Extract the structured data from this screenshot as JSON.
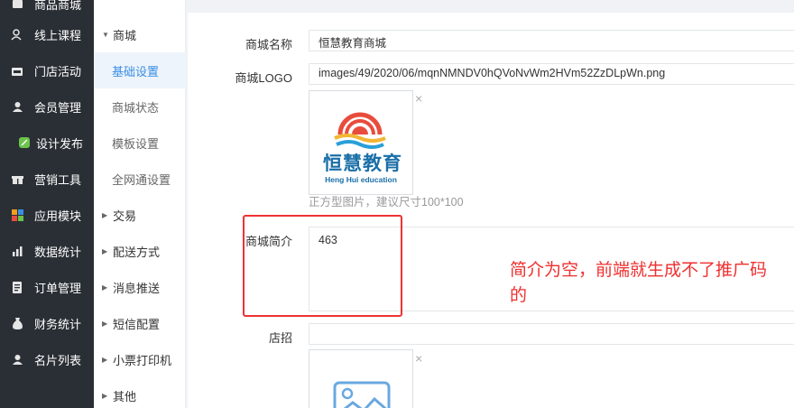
{
  "sidebar": {
    "items": [
      {
        "label": "商品商城",
        "icon": "shop-icon"
      },
      {
        "label": "线上课程",
        "icon": "course-icon"
      },
      {
        "label": "门店活动",
        "icon": "store-icon"
      },
      {
        "label": "会员管理",
        "icon": "user-icon"
      },
      {
        "label": "设计发布",
        "icon": "design-icon"
      },
      {
        "label": "营销工具",
        "icon": "gift-icon"
      },
      {
        "label": "应用模块",
        "icon": "grid-icon"
      },
      {
        "label": "数据统计",
        "icon": "chart-icon"
      },
      {
        "label": "订单管理",
        "icon": "order-icon"
      },
      {
        "label": "财务统计",
        "icon": "money-icon"
      },
      {
        "label": "名片列表",
        "icon": "card-icon"
      }
    ]
  },
  "subnav": {
    "items": [
      {
        "label": "商城",
        "expanded": true
      },
      {
        "label": "基础设置",
        "child": true,
        "active": true
      },
      {
        "label": "商城状态",
        "child": true
      },
      {
        "label": "模板设置",
        "child": true
      },
      {
        "label": "全网通设置",
        "child": true
      },
      {
        "label": "交易"
      },
      {
        "label": "配送方式"
      },
      {
        "label": "消息推送"
      },
      {
        "label": "短信配置"
      },
      {
        "label": "小票打印机"
      },
      {
        "label": "其他"
      }
    ]
  },
  "form": {
    "name_label": "商城名称",
    "name_value": "恒慧教育商城",
    "logo_label": "商城LOGO",
    "logo_value": "images/49/2020/06/mqnNMNDV0hQVoNvWm2HVm52ZzDLpWn.png",
    "logo_image_text": "恒慧教育",
    "logo_image_subtext": "Heng Hui education",
    "logo_hint": "正方型图片，建议尺寸100*100",
    "intro_label": "商城简介",
    "intro_value": "463",
    "sign_label": "店招",
    "sign_value": "",
    "remove_symbol": "×"
  },
  "annotation": {
    "text": "简介为空，前端就生成不了推广码的",
    "color": "#ee2f2f"
  },
  "colors": {
    "sidebar_bg": "#2a2f35",
    "accent": "#3a8ee6",
    "annotation_red": "#ee2f2f"
  }
}
